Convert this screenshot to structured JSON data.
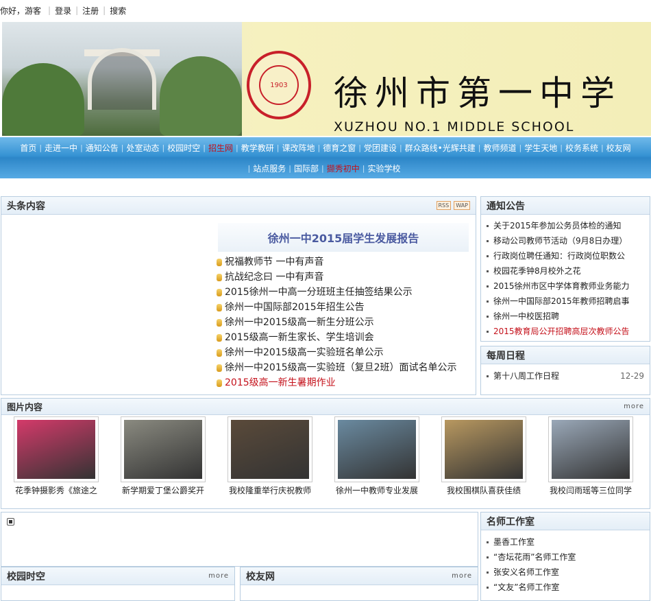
{
  "topbar": {
    "greeting": "你好，游客",
    "login": "登录",
    "register": "注册",
    "search": "搜索"
  },
  "banner": {
    "title_cn": "徐州市第一中学",
    "title_en": "XUZHOU NO.1 MIDDLE SCHOOL",
    "seal_text": "XUZHOU YI ZHONG",
    "seal_year": "1903"
  },
  "nav": {
    "row1": [
      {
        "label": "首页"
      },
      {
        "label": "走进一中"
      },
      {
        "label": "通知公告"
      },
      {
        "label": "处室动态"
      },
      {
        "label": "校园时空"
      },
      {
        "label": "招生网",
        "red": true
      },
      {
        "label": "教学教研"
      },
      {
        "label": "课改阵地"
      },
      {
        "label": "德育之窗"
      },
      {
        "label": "党团建设"
      },
      {
        "label": "群众路线•光辉共建"
      },
      {
        "label": "教师频道"
      },
      {
        "label": "学生天地"
      },
      {
        "label": "校务系统"
      },
      {
        "label": "校友网"
      }
    ],
    "row2": [
      {
        "label": "站点服务"
      },
      {
        "label": "国际部"
      },
      {
        "label": "撷秀初中",
        "red": true
      },
      {
        "label": "实验学校"
      }
    ]
  },
  "headline": {
    "title": "头条内容",
    "rss": "RSS",
    "wap": "WAP",
    "feature": "徐州一中2015届学生发展报告",
    "items": [
      {
        "text": "祝福教师节 一中有声音"
      },
      {
        "text": "抗战纪念曰 一中有声音"
      },
      {
        "text": "2015徐州一中高一分班班主任抽签结果公示"
      },
      {
        "text": "徐州一中国际部2015年招生公告"
      },
      {
        "text": "徐州一中2015级高一新生分班公示"
      },
      {
        "text": "2015级高一新生家长、学生培训会"
      },
      {
        "text": "徐州一中2015级高一实验班名单公示"
      },
      {
        "text": "徐州一中2015级高一实验班（复旦2班）面试名单公示"
      },
      {
        "text": "2015级高一新生暑期作业",
        "red": true
      }
    ]
  },
  "notices": {
    "title": "通知公告",
    "items": [
      {
        "text": "关于2015年参加公务员体检的通知"
      },
      {
        "text": "移动公司教师节活动（9月8日办理）"
      },
      {
        "text": "行政岗位聘任通知：行政岗位职数公"
      },
      {
        "text": "校园花季钟8月校外之花"
      },
      {
        "text": "2015徐州市区中学体育教师业务能力"
      },
      {
        "text": "徐州一中国际部2015年教师招聘启事"
      },
      {
        "text": "徐州一中校医招聘"
      },
      {
        "text": "2015教育局公开招聘高层次教师公告",
        "red": true
      }
    ]
  },
  "schedule": {
    "title": "每周日程",
    "item": "第十八周工作日程",
    "date": "12-29"
  },
  "photos": {
    "title": "图片内容",
    "more": "more",
    "items": [
      {
        "caption": "花季钟摄影秀《旅途之",
        "color": "#d43a6a"
      },
      {
        "caption": "新学期爱丁堡公爵奖开",
        "color": "#8a8a80"
      },
      {
        "caption": "我校隆重举行庆祝教师",
        "color": "#5a4a3a"
      },
      {
        "caption": "徐州一中教师专业发展",
        "color": "#6a8aa0"
      },
      {
        "caption": "我校围棋队喜获佳绩",
        "color": "#b89860"
      },
      {
        "caption": "我校闫雨瑶等三位同学",
        "color": "#9aa8b8"
      }
    ]
  },
  "masters": {
    "title": "名师工作室",
    "items": [
      {
        "text": "墨香工作室"
      },
      {
        "text": "“杏坛花雨”名师工作室"
      },
      {
        "text": "张安义名师工作室"
      },
      {
        "text": "“文友”名师工作室"
      }
    ]
  },
  "campus": {
    "title": "校园时空",
    "more": "more"
  },
  "alumni": {
    "title": "校友网",
    "more": "more"
  }
}
